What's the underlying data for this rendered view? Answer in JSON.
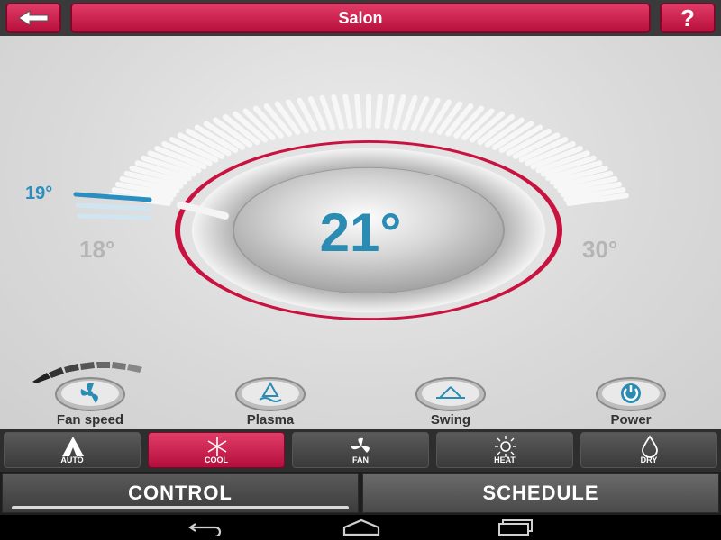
{
  "header": {
    "title": "Salon",
    "back_icon": "back-arrow-icon",
    "help_label": "?"
  },
  "thermostat": {
    "current_setpoint": "21°",
    "min_label": "18°",
    "max_label": "30°",
    "indicator_label": "19°",
    "accent_color": "#c8123f",
    "temp_color": "#2a8bb3"
  },
  "functions": [
    {
      "label": "Fan speed",
      "icon": "fan-icon"
    },
    {
      "label": "Plasma",
      "icon": "plasma-icon"
    },
    {
      "label": "Swing",
      "icon": "swing-icon"
    },
    {
      "label": "Power",
      "icon": "power-icon"
    }
  ],
  "modes": [
    {
      "label": "AUTO",
      "icon": "auto-icon",
      "active": false
    },
    {
      "label": "COOL",
      "icon": "snowflake-icon",
      "active": true
    },
    {
      "label": "FAN",
      "icon": "fan-blade-icon",
      "active": false
    },
    {
      "label": "HEAT",
      "icon": "sun-icon",
      "active": false
    },
    {
      "label": "DRY",
      "icon": "droplet-icon",
      "active": false
    }
  ],
  "tabs": [
    {
      "label": "CONTROL",
      "selected": true
    },
    {
      "label": "SCHEDULE",
      "selected": false
    }
  ],
  "nav": {
    "back_icon": "nav-back-icon",
    "home_icon": "nav-home-icon",
    "recents_icon": "nav-recents-icon"
  }
}
